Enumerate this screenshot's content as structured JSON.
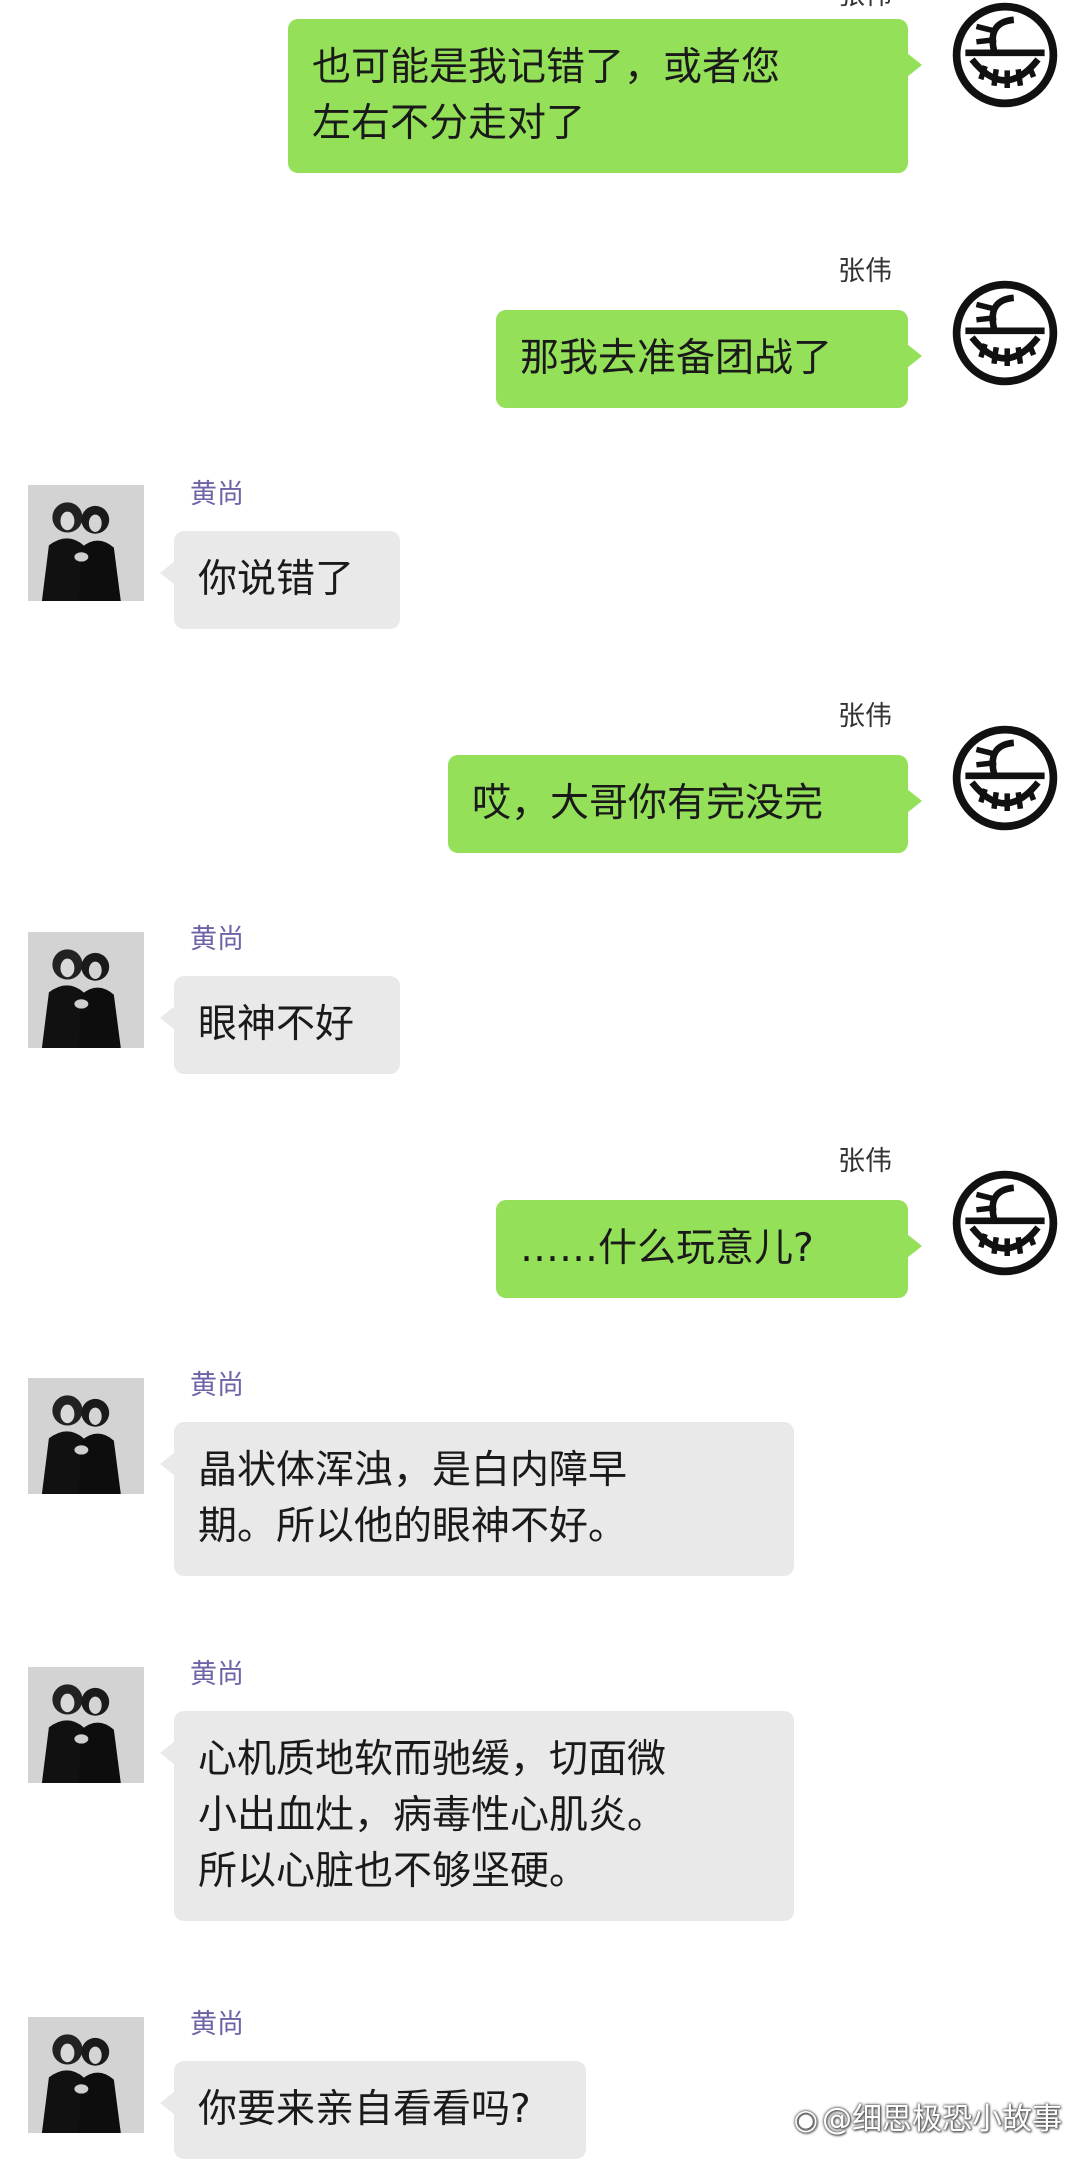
{
  "contacts": {
    "self": {
      "name": "张伟",
      "avatar_icon": "smiling-face-doodle-avatar-icon"
    },
    "other": {
      "name": "黄尚",
      "avatar_icon": "black-white-portrait-photo-avatar"
    }
  },
  "colors": {
    "self_bubble": "#94e159",
    "other_bubble": "#e9e9e9",
    "other_name": "#6f62a6",
    "self_name": "#333333",
    "background": "#ffffff"
  },
  "messages": [
    {
      "sender": "self",
      "name": "张伟",
      "text": "也可能是我记错了，或者您\n左右不分走对了"
    },
    {
      "sender": "self",
      "name": "张伟",
      "text": "那我去准备团战了"
    },
    {
      "sender": "other",
      "name": "黄尚",
      "text": "你说错了"
    },
    {
      "sender": "self",
      "name": "张伟",
      "text": "哎，大哥你有完没完"
    },
    {
      "sender": "other",
      "name": "黄尚",
      "text": "眼神不好"
    },
    {
      "sender": "self",
      "name": "张伟",
      "text": "……什么玩意儿?"
    },
    {
      "sender": "other",
      "name": "黄尚",
      "text": "晶状体浑浊，是白内障早\n期。所以他的眼神不好。"
    },
    {
      "sender": "other",
      "name": "黄尚",
      "text": "心机质地软而驰缓，切面微\n小出血灶，病毒性心肌炎。\n所以心脏也不够坚硬。"
    },
    {
      "sender": "other",
      "name": "黄尚",
      "text": "你要来亲自看看吗?"
    }
  ],
  "watermark": {
    "icon": "weibo-logo-icon",
    "text": "@细思极恐小故事"
  }
}
